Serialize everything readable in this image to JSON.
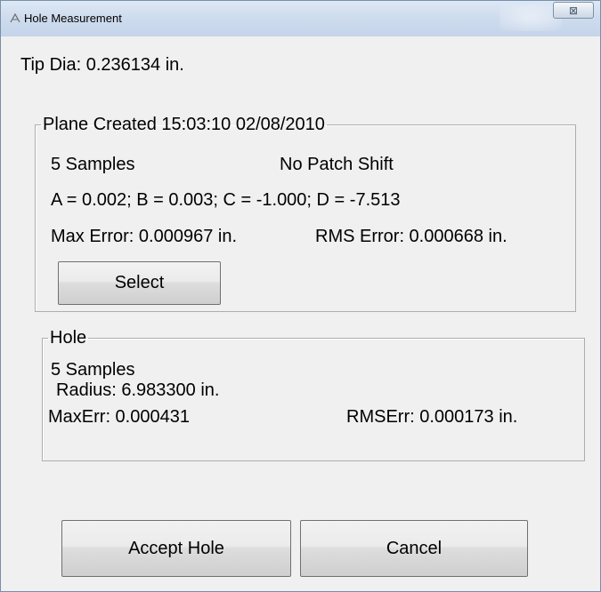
{
  "window": {
    "title": "Hole Measurement",
    "close_glyph": "⊠"
  },
  "tip": {
    "label": "Tip Dia: 0.236134 in."
  },
  "plane": {
    "legend": "Plane Created 15:03:10 02/08/2010",
    "samples": "5 Samples",
    "patch": "No Patch Shift",
    "equation": "A =  0.002; B =  0.003; C = -1.000; D =  -7.513",
    "max_error": "Max Error: 0.000967 in.",
    "rms_error": "RMS Error: 0.000668 in.",
    "select_label": "Select"
  },
  "hole": {
    "legend": "Hole",
    "samples": "5 Samples",
    "radius": "Radius: 6.983300 in.",
    "max_err": "MaxErr: 0.000431",
    "rms_err": "RMSErr: 0.000173 in."
  },
  "actions": {
    "accept_label": "Accept Hole",
    "cancel_label": "Cancel"
  }
}
